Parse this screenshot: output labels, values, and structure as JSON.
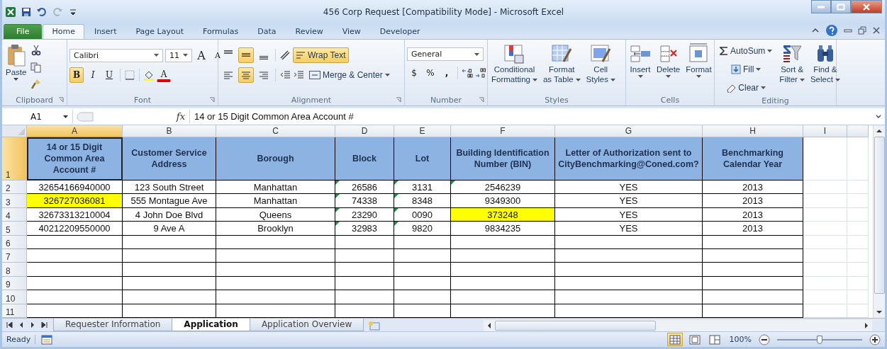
{
  "window": {
    "title": "456 Corp Request  [Compatibility Mode]  -  Microsoft Excel"
  },
  "ribbon_tabs": [
    {
      "label": "File",
      "selected": false,
      "kind": "file"
    },
    {
      "label": "Home",
      "selected": true,
      "kind": "tab"
    },
    {
      "label": "Insert",
      "selected": false,
      "kind": "tab"
    },
    {
      "label": "Page Layout",
      "selected": false,
      "kind": "tab"
    },
    {
      "label": "Formulas",
      "selected": false,
      "kind": "tab"
    },
    {
      "label": "Data",
      "selected": false,
      "kind": "tab"
    },
    {
      "label": "Review",
      "selected": false,
      "kind": "tab"
    },
    {
      "label": "View",
      "selected": false,
      "kind": "tab"
    },
    {
      "label": "Developer",
      "selected": false,
      "kind": "tab"
    }
  ],
  "clipboard": {
    "paste": "Paste",
    "label": "Clipboard"
  },
  "font": {
    "family": "Calibri",
    "size": "11",
    "grow": "A",
    "shrink": "A",
    "color_label": "A",
    "label": "Font",
    "styles": [
      {
        "label": "B",
        "on": true,
        "kind": "bold"
      },
      {
        "label": "I",
        "on": false,
        "kind": "italic"
      },
      {
        "label": "U",
        "on": false,
        "kind": "underline"
      }
    ]
  },
  "alignment": {
    "label": "Alignment",
    "merge": "Merge & Center",
    "wrap_text": {
      "label": "Wrap Text",
      "on": true
    },
    "vertical": [
      {
        "selected": false
      },
      {
        "selected": true
      },
      {
        "selected": false
      }
    ],
    "horizontal": [
      {
        "selected": false
      },
      {
        "selected": true
      },
      {
        "selected": false
      }
    ]
  },
  "number": {
    "format": "General",
    "currency": "$",
    "percent": "%",
    "comma": ",",
    "label": "Number"
  },
  "styles": {
    "label": "Styles",
    "buttons": [
      {
        "lines": [
          "Conditional",
          "Formatting"
        ]
      },
      {
        "lines": [
          "Format",
          "as Table"
        ]
      },
      {
        "lines": [
          "Cell",
          "Styles"
        ]
      }
    ]
  },
  "cells_group": {
    "label": "Cells",
    "buttons": [
      "Insert",
      "Delete",
      "Format"
    ]
  },
  "editing": {
    "label": "Editing",
    "autosum": "AutoSum",
    "fill": "Fill",
    "clear": "Clear",
    "sort": [
      "Sort &",
      "Filter"
    ],
    "find": [
      "Find &",
      "Select"
    ]
  },
  "formula_bar": {
    "name_box": "A1",
    "fx": "fx",
    "formula": "14 or 15 Digit Common Area Account #"
  },
  "sheet": {
    "columns": [
      {
        "label": "A",
        "selected": true
      },
      {
        "label": "B",
        "selected": false
      },
      {
        "label": "C",
        "selected": false
      },
      {
        "label": "D",
        "selected": false
      },
      {
        "label": "E",
        "selected": false
      },
      {
        "label": "F",
        "selected": false
      },
      {
        "label": "G",
        "selected": false
      },
      {
        "label": "H",
        "selected": false
      },
      {
        "label": "I",
        "selected": false
      }
    ],
    "header_row": {
      "number": "1",
      "selected": true,
      "cells": [
        {
          "text": "14 or 15 Digit Common Area Account #",
          "selected": true
        },
        {
          "text": "Customer Service Address",
          "selected": false
        },
        {
          "text": "Borough",
          "selected": false
        },
        {
          "text": "Block",
          "selected": false
        },
        {
          "text": "Lot",
          "selected": false
        },
        {
          "text": "Building Identification Number (BIN)",
          "selected": false
        },
        {
          "text": "Letter of Authorization sent to CityBenchmarking@Coned.com?",
          "selected": false
        },
        {
          "text": "Benchmarking Calendar Year",
          "selected": false
        }
      ]
    },
    "rows": [
      {
        "number": "2",
        "selected": false,
        "cells": [
          {
            "text": "32654166940000",
            "highlighted": false,
            "flag": false
          },
          {
            "text": "123 South Street",
            "highlighted": false,
            "flag": false
          },
          {
            "text": "Manhattan",
            "highlighted": false,
            "flag": false
          },
          {
            "text": "26586",
            "highlighted": false,
            "flag": true
          },
          {
            "text": "3131",
            "highlighted": false,
            "flag": true
          },
          {
            "text": "2546239",
            "highlighted": false,
            "flag": true
          },
          {
            "text": "YES",
            "highlighted": false,
            "flag": false
          },
          {
            "text": "2013",
            "highlighted": false,
            "flag": false
          }
        ]
      },
      {
        "number": "3",
        "selected": false,
        "cells": [
          {
            "text": "326727036081",
            "highlighted": true,
            "flag": false
          },
          {
            "text": "555 Montague Ave",
            "highlighted": false,
            "flag": false
          },
          {
            "text": "Manhattan",
            "highlighted": false,
            "flag": false
          },
          {
            "text": "74338",
            "highlighted": false,
            "flag": true
          },
          {
            "text": "8348",
            "highlighted": false,
            "flag": true
          },
          {
            "text": "9349300",
            "highlighted": false,
            "flag": false
          },
          {
            "text": "YES",
            "highlighted": false,
            "flag": false
          },
          {
            "text": "2013",
            "highlighted": false,
            "flag": false
          }
        ]
      },
      {
        "number": "4",
        "selected": false,
        "cells": [
          {
            "text": "32673313210004",
            "highlighted": false,
            "flag": false
          },
          {
            "text": "4 John Doe Blvd",
            "highlighted": false,
            "flag": false
          },
          {
            "text": "Queens",
            "highlighted": false,
            "flag": false
          },
          {
            "text": "23290",
            "highlighted": false,
            "flag": true
          },
          {
            "text": "0090",
            "highlighted": false,
            "flag": true
          },
          {
            "text": "373248",
            "highlighted": true,
            "flag": false
          },
          {
            "text": "YES",
            "highlighted": false,
            "flag": false
          },
          {
            "text": "2013",
            "highlighted": false,
            "flag": false
          }
        ]
      },
      {
        "number": "5",
        "selected": false,
        "cells": [
          {
            "text": "40212209550000",
            "highlighted": false,
            "flag": false
          },
          {
            "text": "9 Ave A",
            "highlighted": false,
            "flag": false
          },
          {
            "text": "Brooklyn",
            "highlighted": false,
            "flag": false
          },
          {
            "text": "32983",
            "highlighted": false,
            "flag": true
          },
          {
            "text": "9820",
            "highlighted": false,
            "flag": true
          },
          {
            "text": "9834235",
            "highlighted": false,
            "flag": false
          },
          {
            "text": "YES",
            "highlighted": false,
            "flag": false
          },
          {
            "text": "2013",
            "highlighted": false,
            "flag": false
          }
        ]
      }
    ],
    "empty_rows": [
      {
        "number": "6",
        "selected": false
      },
      {
        "number": "7",
        "selected": false
      },
      {
        "number": "8",
        "selected": false
      },
      {
        "number": "9",
        "selected": false
      },
      {
        "number": "10",
        "selected": false
      },
      {
        "number": "11",
        "selected": false
      }
    ]
  },
  "sheet_tabs": [
    {
      "label": "Requester Information",
      "selected": false
    },
    {
      "label": "Application",
      "selected": true
    },
    {
      "label": "Application Overview",
      "selected": false
    }
  ],
  "status_bar": {
    "status": "Ready",
    "views": [
      {
        "selected": true
      },
      {
        "selected": false
      },
      {
        "selected": false
      }
    ],
    "zoom": "100%",
    "zoom_slider": {
      "level": 0.5
    }
  }
}
